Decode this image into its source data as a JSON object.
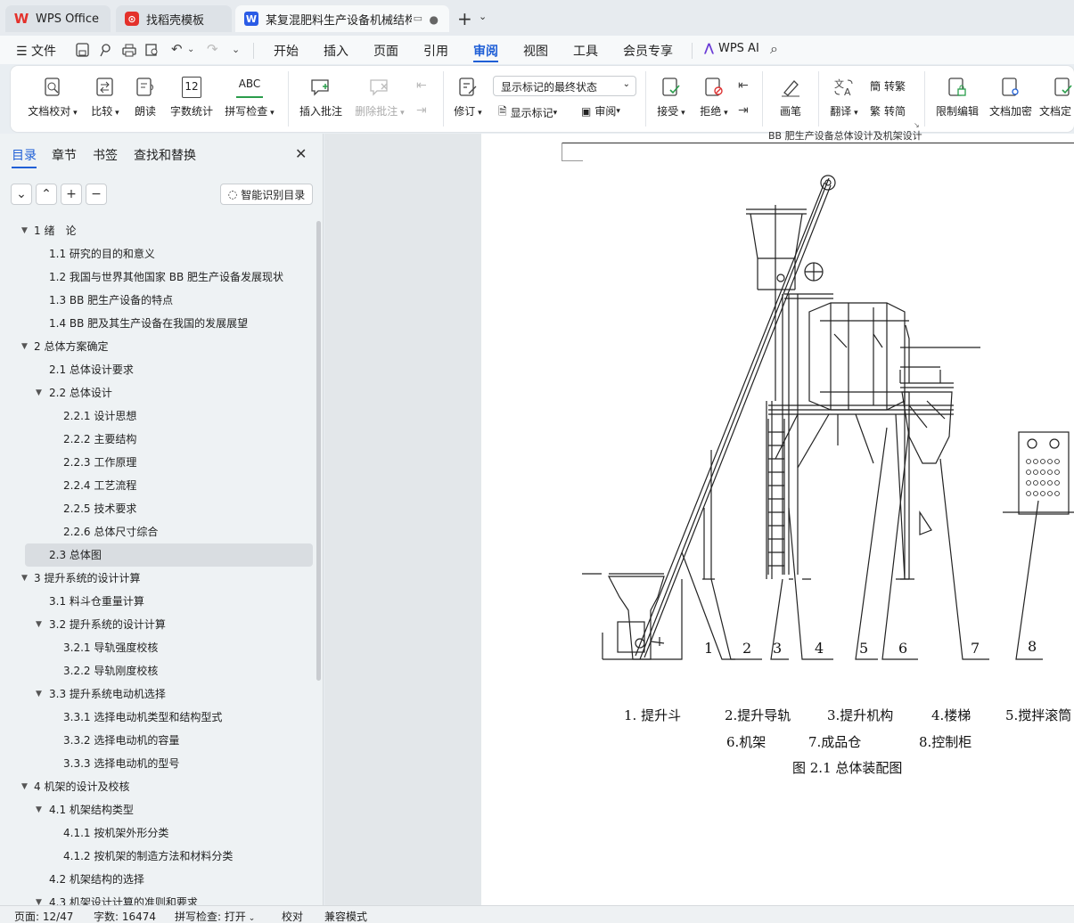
{
  "tabs": [
    {
      "label": "WPS Office"
    },
    {
      "label": "找稻壳模板"
    },
    {
      "label": "某复混肥料生产设备机械结构设"
    }
  ],
  "menu": {
    "file": "文件",
    "items": [
      "开始",
      "插入",
      "页面",
      "引用",
      "审阅",
      "视图",
      "工具",
      "会员专享"
    ],
    "active": "审阅",
    "wps_ai": "WPS AI"
  },
  "ribbon": {
    "doc_check": "文档校对",
    "compare": "比较",
    "read_aloud": "朗读",
    "word_count": "字数统计",
    "word_count_icon": "12",
    "spell_check": "拼写检查",
    "spell_icon": "ABC",
    "insert_comment": "插入批注",
    "delete_comment": "删除批注",
    "revise": "修订",
    "markup_dropdown": "显示标记的最终状态",
    "show_markup": "显示标记",
    "review": "审阅",
    "accept": "接受",
    "reject": "拒绝",
    "pen": "画笔",
    "translate": "翻译",
    "to_traditional": "转繁",
    "to_simplified": "转简",
    "restrict_edit": "限制编辑",
    "doc_encrypt": "文档加密",
    "doc_final": "文档定"
  },
  "nav": {
    "tabs": [
      "目录",
      "章节",
      "书签",
      "查找和替换"
    ],
    "smart_btn": "智能识别目录",
    "toc": [
      {
        "text": "1  绪　论",
        "level": 0,
        "arrow": "▼"
      },
      {
        "text": "1.1 研究的目的和意义",
        "level": 1
      },
      {
        "text": "1.2  我国与世界其他国家 BB 肥生产设备发展现状",
        "level": 1
      },
      {
        "text": "1.3 BB 肥生产设备的特点",
        "level": 1
      },
      {
        "text": "1.4 BB 肥及其生产设备在我国的发展展望",
        "level": 1
      },
      {
        "text": "2  总体方案确定",
        "level": 0,
        "arrow": "▼"
      },
      {
        "text": "2.1  总体设计要求",
        "level": 1
      },
      {
        "text": "2.2  总体设计",
        "level": 1,
        "arrow": "▼"
      },
      {
        "text": "2.2.1  设计思想",
        "level": 2
      },
      {
        "text": "2.2.2  主要结构",
        "level": 2
      },
      {
        "text": "2.2.3  工作原理",
        "level": 2
      },
      {
        "text": "2.2.4  工艺流程",
        "level": 2
      },
      {
        "text": "2.2.5  技术要求",
        "level": 2
      },
      {
        "text": "2.2.6  总体尺寸综合",
        "level": 2
      },
      {
        "text": "2.3  总体图",
        "level": 1,
        "selected": true
      },
      {
        "text": "3  提升系统的设计计算",
        "level": 0,
        "arrow": "▼"
      },
      {
        "text": "3.1  料斗仓重量计算",
        "level": 1
      },
      {
        "text": "3.2  提升系统的设计计算",
        "level": 1,
        "arrow": "▼"
      },
      {
        "text": "3.2.1  导轨强度校核",
        "level": 2
      },
      {
        "text": "3.2.2  导轨刚度校核",
        "level": 2
      },
      {
        "text": "3.3  提升系统电动机选择",
        "level": 1,
        "arrow": "▼"
      },
      {
        "text": "3.3.1   选择电动机类型和结构型式",
        "level": 2
      },
      {
        "text": "3.3.2  选择电动机的容量",
        "level": 2
      },
      {
        "text": "3.3.3 选择电动机的型号",
        "level": 2
      },
      {
        "text": "4  机架的设计及校核",
        "level": 0,
        "arrow": "▼"
      },
      {
        "text": "4.1 机架结构类型",
        "level": 1,
        "arrow": "▼"
      },
      {
        "text": "4.1.1  按机架外形分类",
        "level": 2
      },
      {
        "text": "4.1.2  按机架的制造方法和材料分类",
        "level": 2
      },
      {
        "text": "4.2  机架结构的选择",
        "level": 1
      },
      {
        "text": "4.3  机架设计计算的准则和要求",
        "level": 1,
        "arrow": "▼"
      }
    ]
  },
  "document": {
    "header_text": "BB 肥生产设备总体设计及机架设计",
    "figure_numbers": [
      "1",
      "2",
      "3",
      "4",
      "5",
      "6",
      "7",
      "8"
    ],
    "legend_line1": [
      "1.  提升斗",
      "2.提升导轨",
      "3.提升机构",
      "4.楼梯",
      "5.搅拌滚筒"
    ],
    "legend_line2": [
      "6.机架",
      "7.成品仓",
      "8.控制柜"
    ],
    "caption": "图 2.1  总体装配图"
  },
  "status": {
    "page": "页面: 12/47",
    "words": "字数: 16474",
    "spell": "拼写检查: 打开",
    "proof": "校对",
    "compat": "兼容模式"
  },
  "colors": {
    "accent": "#1f5fd6",
    "wps_red": "#e4312b",
    "word_blue": "#2b5ce6"
  }
}
